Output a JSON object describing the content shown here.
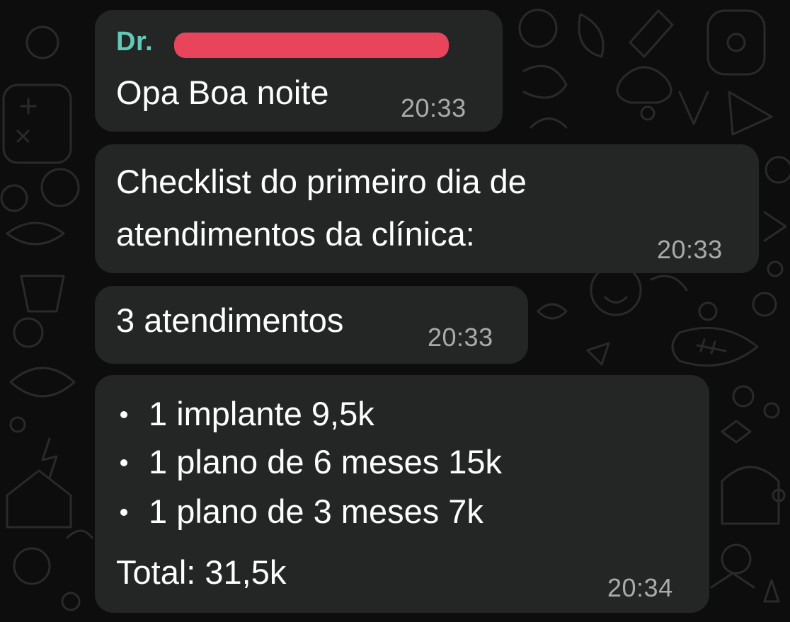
{
  "chat": {
    "background_color": "#0d0d0d",
    "bubble_color": "#242626",
    "sender_color": "#62c9b8",
    "messages": [
      {
        "sender": "Dr.",
        "text": "Opa Boa noite",
        "time": "20:33"
      },
      {
        "line1": "Checklist do primeiro dia de",
        "line2": "atendimentos da clínica:",
        "time": "20:33"
      },
      {
        "text": "3 atendimentos",
        "time": "20:33"
      },
      {
        "bullets": [
          "1 implante 9,5k",
          "1 plano de 6 meses 15k",
          "1 plano de 3 meses 7k"
        ],
        "total": "Total: 31,5k",
        "time": "20:34"
      }
    ]
  }
}
